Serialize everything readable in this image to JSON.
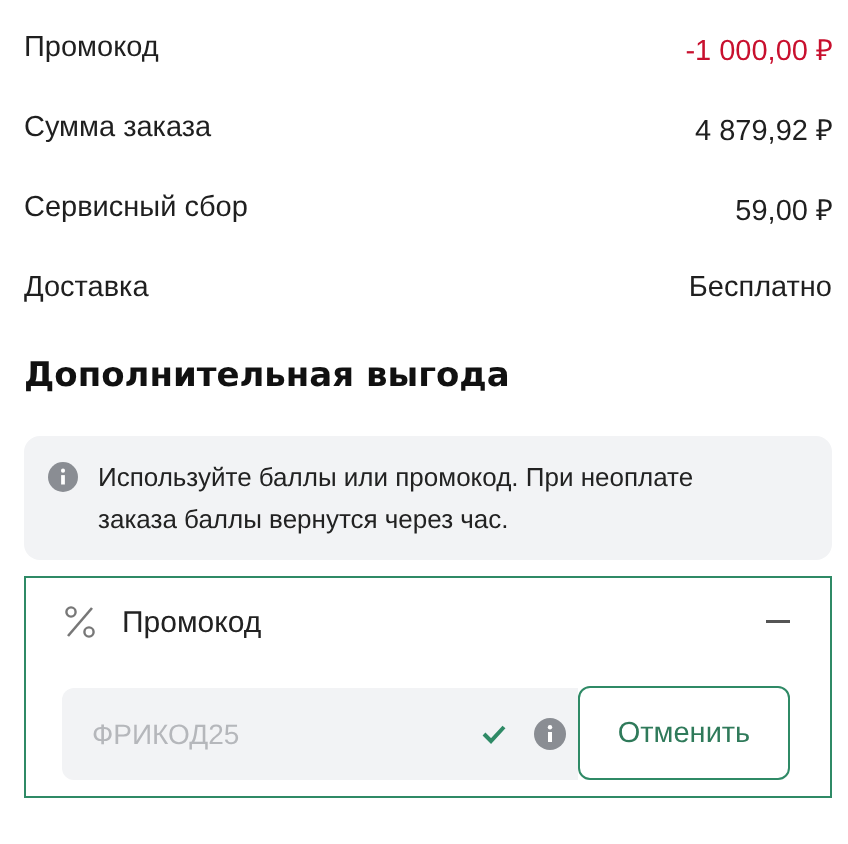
{
  "summary": [
    {
      "label": "Промокод",
      "value": "-1 000,00 ₽",
      "kind": "discount"
    },
    {
      "label": "Сумма заказа",
      "value": "4 879,92 ₽",
      "kind": "amount"
    },
    {
      "label": "Сервисный сбор",
      "value": "59,00 ₽",
      "kind": "amount"
    },
    {
      "label": "Доставка",
      "value": "Бесплатно",
      "kind": "amount"
    }
  ],
  "extra": {
    "title": "Дополнительная выгода",
    "notice": "Используйте баллы или промокод. При неоплате заказа баллы вернутся через час.",
    "promo": {
      "title": "Промокод",
      "expanded": true,
      "code": "ФРИКОД25",
      "disabled": true,
      "applied": true,
      "button": "Отменить"
    }
  }
}
